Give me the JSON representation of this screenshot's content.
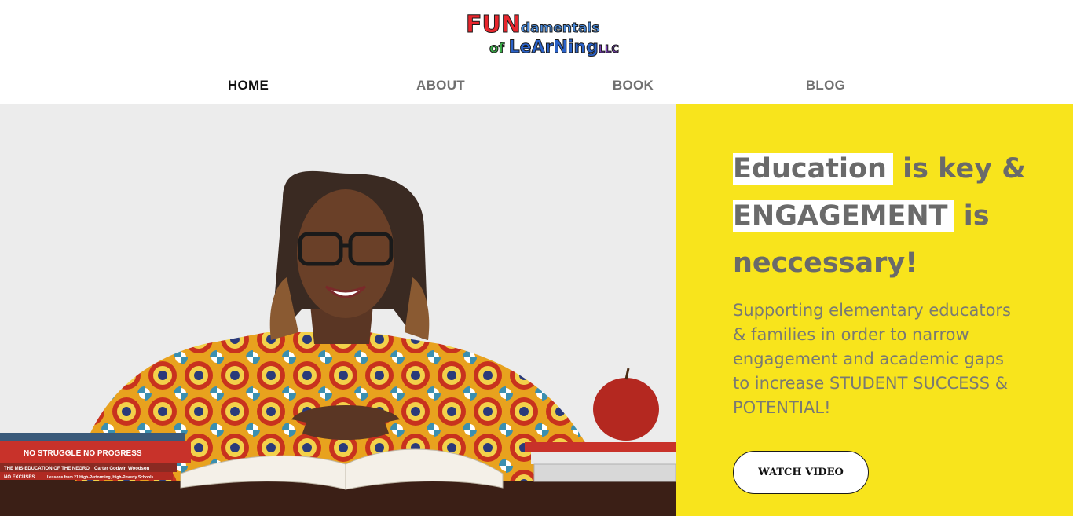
{
  "logo": {
    "line1_big": "FUN",
    "line1_small": "damentals",
    "line2_small": "of",
    "line2_big": "LeArNing",
    "line2_suffix": "LLC"
  },
  "nav": {
    "items": [
      {
        "label": "HOME"
      },
      {
        "label": "ABOUT"
      },
      {
        "label": "BOOK"
      },
      {
        "label": "BLOG"
      }
    ]
  },
  "hero": {
    "headline_hl1": "Education",
    "headline_part2": " is key &",
    "headline_hl2": "ENGAGEMENT",
    "headline_part4": " is",
    "headline_part5": "neccessary!",
    "subtext": "Supporting elementary educators & families in order to narrow engagement and academic gaps to increase STUDENT SUCCESS & POTENTIAL!",
    "button_label": "WATCH VIDEO"
  },
  "photo": {
    "book1_title": "NO STRUGGLE NO PROGRESS",
    "book2_title": "THE MIS-EDUCATION OF THE NEGRO",
    "book2_author": "Carter Godwin Woodson",
    "book3_title": "NO EXCUSES",
    "book3_subtitle": "Lessons from 21 High-Performing, High-Poverty Schools"
  },
  "colors": {
    "accent_yellow": "#f8e41c",
    "nav_active": "#111111",
    "nav_inactive": "#707070",
    "photo_bg": "#ececec"
  }
}
